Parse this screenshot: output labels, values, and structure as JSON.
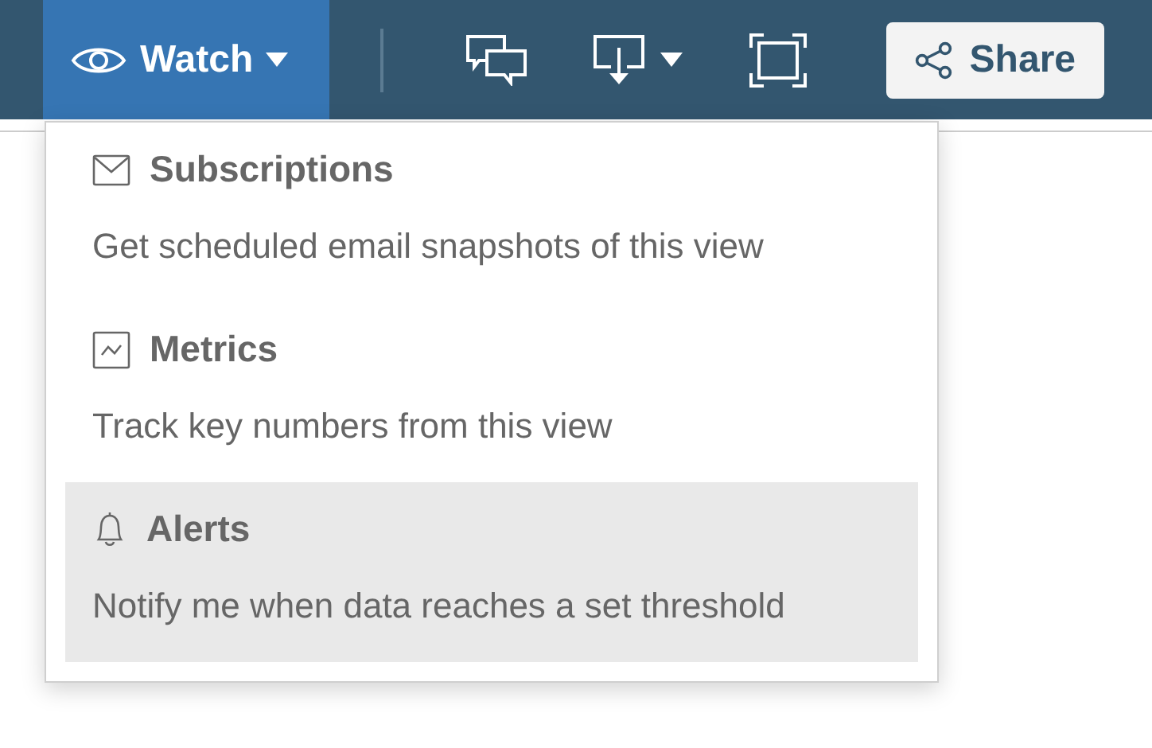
{
  "toolbar": {
    "watch_button": {
      "label": "Watch",
      "expanded": true
    },
    "share_button": {
      "label": "Share"
    }
  },
  "watch_menu": {
    "items": [
      {
        "kind": "subscriptions",
        "title": "Subscriptions",
        "description": "Get scheduled email snapshots of this view",
        "selected": false
      },
      {
        "kind": "metrics",
        "title": "Metrics",
        "description": "Track key numbers from this view",
        "selected": false
      },
      {
        "kind": "alerts",
        "title": "Alerts",
        "description": "Notify me when data reaches a set threshold",
        "selected": true
      }
    ]
  }
}
